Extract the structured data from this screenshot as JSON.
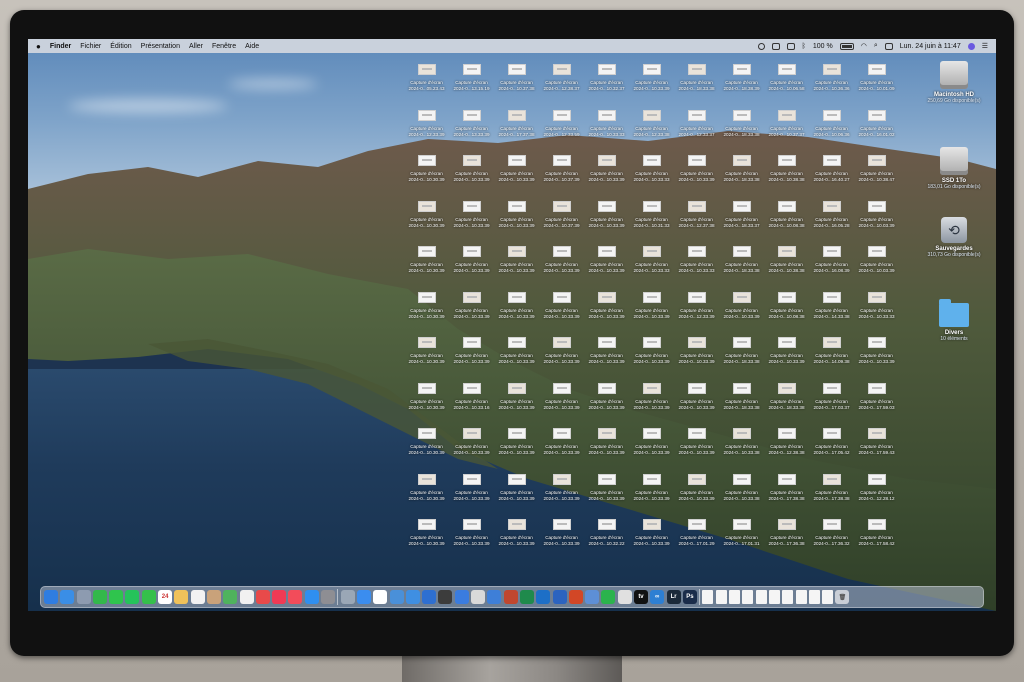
{
  "menubar": {
    "apple": "",
    "app": "Finder",
    "menus": [
      "Fichier",
      "Édition",
      "Présentation",
      "Aller",
      "Fenêtre",
      "Aide"
    ],
    "battery": "100 %",
    "clock": "Lun. 24 juin à 11:47"
  },
  "desktop": {
    "volumes": [
      {
        "name": "Macintosh HD",
        "info": "250,69 Go disponible(s)",
        "icon": "hard-disk-icon"
      },
      {
        "name": "SSD 1To",
        "info": "183,01 Go disponible(s)",
        "icon": "hard-disk-icon"
      },
      {
        "name": "Sauvegardes",
        "info": "310,73 Go disponible(s)",
        "icon": "time-machine-icon"
      },
      {
        "name": "Divers",
        "info": "10 éléments",
        "icon": "folder-icon"
      }
    ],
    "files": [
      [
        [
          "Capture d'écran",
          "2024-0...05.23.43"
        ],
        [
          "Capture d'écran",
          "2024-0...13.15.19"
        ],
        [
          "Capture d'écran",
          "2024-0...10.37.38"
        ],
        [
          "Capture d'écran",
          "2024-0...12.38.37"
        ],
        [
          "Capture d'écran",
          "2024-0...10.32.37"
        ],
        [
          "Capture d'écran",
          "2024-0...10.33.39"
        ],
        [
          "Capture d'écran",
          "2024-0...18.33.38"
        ],
        [
          "Capture d'écran",
          "2024-0...18.38.39"
        ],
        [
          "Capture d'écran",
          "2024-0...10.06.58"
        ],
        [
          "Capture d'écran",
          "2024-0...10.36.36"
        ],
        [
          "Capture d'écran",
          "2024-0...10.01.09"
        ]
      ],
      [
        [
          "Capture d'écran",
          "2024-0...12.33.39"
        ],
        [
          "Capture d'écran",
          "2024-0...13.33.39"
        ],
        [
          "Capture d'écran",
          "2024-0...17.37.38"
        ],
        [
          "Capture d'écran",
          "2024-0...12.33.59"
        ],
        [
          "Capture d'écran",
          "2024-0...10.33.33"
        ],
        [
          "Capture d'écran",
          "2024-0...12.33.38"
        ],
        [
          "Capture d'écran",
          "2024-0...12.33.37"
        ],
        [
          "Capture d'écran",
          "2024-0...18.33.38"
        ],
        [
          "Capture d'écran",
          "2024-0...10.37.37"
        ],
        [
          "Capture d'écran",
          "2024-0...10.06.36"
        ],
        [
          "Capture d'écran",
          "2024-0...16.01.02"
        ]
      ],
      [
        [
          "Capture d'écran",
          "2024-0...10.30.39"
        ],
        [
          "Capture d'écran",
          "2024-0...10.33.39"
        ],
        [
          "Capture d'écran",
          "2024-0...10.33.39"
        ],
        [
          "Capture d'écran",
          "2024-0...10.37.39"
        ],
        [
          "Capture d'écran",
          "2024-0...10.33.39"
        ],
        [
          "Capture d'écran",
          "2024-0...10.33.33"
        ],
        [
          "Capture d'écran",
          "2024-0...10.33.39"
        ],
        [
          "Capture d'écran",
          "2024-0...18.33.38"
        ],
        [
          "Capture d'écran",
          "2024-0...10.38.38"
        ],
        [
          "Capture d'écran",
          "2024-0...16.40.27"
        ],
        [
          "Capture d'écran",
          "2024-0...10.38.47"
        ]
      ],
      [
        [
          "Capture d'écran",
          "2024-0...10.30.39"
        ],
        [
          "Capture d'écran",
          "2024-0...10.33.39"
        ],
        [
          "Capture d'écran",
          "2024-0...10.33.39"
        ],
        [
          "Capture d'écran",
          "2024-0...10.37.39"
        ],
        [
          "Capture d'écran",
          "2024-0...10.33.39"
        ],
        [
          "Capture d'écran",
          "2024-0...10.31.33"
        ],
        [
          "Capture d'écran",
          "2024-0...12.37.38"
        ],
        [
          "Capture d'écran",
          "2024-0...18.33.37"
        ],
        [
          "Capture d'écran",
          "2024-0...10.08.38"
        ],
        [
          "Capture d'écran",
          "2024-0...16.05.28"
        ],
        [
          "Capture d'écran",
          "2024-0...10.03.39"
        ]
      ],
      [
        [
          "Capture d'écran",
          "2024-0...10.30.39"
        ],
        [
          "Capture d'écran",
          "2024-0...10.33.39"
        ],
        [
          "Capture d'écran",
          "2024-0...10.33.39"
        ],
        [
          "Capture d'écran",
          "2024-0...10.33.39"
        ],
        [
          "Capture d'écran",
          "2024-0...10.33.39"
        ],
        [
          "Capture d'écran",
          "2024-0...10.33.33"
        ],
        [
          "Capture d'écran",
          "2024-0...10.33.33"
        ],
        [
          "Capture d'écran",
          "2024-0...18.33.38"
        ],
        [
          "Capture d'écran",
          "2024-0...10.38.38"
        ],
        [
          "Capture d'écran",
          "2024-0...16.08.39"
        ],
        [
          "Capture d'écran",
          "2024-0...10.03.39"
        ]
      ],
      [
        [
          "Capture d'écran",
          "2024-0...10.30.39"
        ],
        [
          "Capture d'écran",
          "2024-0...10.33.39"
        ],
        [
          "Capture d'écran",
          "2024-0...10.33.39"
        ],
        [
          "Capture d'écran",
          "2024-0...10.33.39"
        ],
        [
          "Capture d'écran",
          "2024-0...10.33.39"
        ],
        [
          "Capture d'écran",
          "2024-0...10.33.39"
        ],
        [
          "Capture d'écran",
          "2024-0...12.33.39"
        ],
        [
          "Capture d'écran",
          "2024-0...10.33.39"
        ],
        [
          "Capture d'écran",
          "2024-0...10.08.38"
        ],
        [
          "Capture d'écran",
          "2024-0...14.33.38"
        ],
        [
          "Capture d'écran",
          "2024-0...10.33.33"
        ]
      ],
      [
        [
          "Capture d'écran",
          "2024-0...10.30.39"
        ],
        [
          "Capture d'écran",
          "2024-0...10.33.39"
        ],
        [
          "Capture d'écran",
          "2024-0...10.33.39"
        ],
        [
          "Capture d'écran",
          "2024-0...10.33.39"
        ],
        [
          "Capture d'écran",
          "2024-0...10.33.39"
        ],
        [
          "Capture d'écran",
          "2024-0...10.33.39"
        ],
        [
          "Capture d'écran",
          "2024-0...10.33.39"
        ],
        [
          "Capture d'écran",
          "2024-0...18.33.38"
        ],
        [
          "Capture d'écran",
          "2024-0...10.33.39"
        ],
        [
          "Capture d'écran",
          "2024-0...14.09.38"
        ],
        [
          "Capture d'écran",
          "2024-0...10.33.39"
        ]
      ],
      [
        [
          "Capture d'écran",
          "2024-0...10.30.39"
        ],
        [
          "Capture d'écran",
          "2024-0...10.33.16"
        ],
        [
          "Capture d'écran",
          "2024-0...10.33.39"
        ],
        [
          "Capture d'écran",
          "2024-0...10.33.39"
        ],
        [
          "Capture d'écran",
          "2024-0...10.33.39"
        ],
        [
          "Capture d'écran",
          "2024-0...10.33.39"
        ],
        [
          "Capture d'écran",
          "2024-0...10.33.39"
        ],
        [
          "Capture d'écran",
          "2024-0...18.33.38"
        ],
        [
          "Capture d'écran",
          "2024-0...18.33.38"
        ],
        [
          "Capture d'écran",
          "2024-0...17.03.37"
        ],
        [
          "Capture d'écran",
          "2024-0...17.59.03"
        ]
      ],
      [
        [
          "Capture d'écran",
          "2024-0...10.30.39"
        ],
        [
          "Capture d'écran",
          "2024-0...10.33.39"
        ],
        [
          "Capture d'écran",
          "2024-0...10.33.39"
        ],
        [
          "Capture d'écran",
          "2024-0...10.33.39"
        ],
        [
          "Capture d'écran",
          "2024-0...10.33.39"
        ],
        [
          "Capture d'écran",
          "2024-0...10.33.39"
        ],
        [
          "Capture d'écran",
          "2024-0...10.33.39"
        ],
        [
          "Capture d'écran",
          "2024-0...10.33.38"
        ],
        [
          "Capture d'écran",
          "2024-0...12.38.38"
        ],
        [
          "Capture d'écran",
          "2024-0...17.05.42"
        ],
        [
          "Capture d'écran",
          "2024-0...17.59.43"
        ]
      ],
      [
        [
          "Capture d'écran",
          "2024-0...10.30.39"
        ],
        [
          "Capture d'écran",
          "2024-0...10.33.39"
        ],
        [
          "Capture d'écran",
          "2024-0...10.33.39"
        ],
        [
          "Capture d'écran",
          "2024-0...10.33.39"
        ],
        [
          "Capture d'écran",
          "2024-0...10.33.39"
        ],
        [
          "Capture d'écran",
          "2024-0...10.33.39"
        ],
        [
          "Capture d'écran",
          "2024-0...10.33.39"
        ],
        [
          "Capture d'écran",
          "2024-0...10.33.38"
        ],
        [
          "Capture d'écran",
          "2024-0...17.38.38"
        ],
        [
          "Capture d'écran",
          "2024-0...17.38.38"
        ],
        [
          "Capture d'écran",
          "2024-0...12.28.12"
        ]
      ],
      [
        [
          "Capture d'écran",
          "2024-0...10.30.39"
        ],
        [
          "Capture d'écran",
          "2024-0...10.33.39"
        ],
        [
          "Capture d'écran",
          "2024-0...10.33.39"
        ],
        [
          "Capture d'écran",
          "2024-0...10.33.39"
        ],
        [
          "Capture d'écran",
          "2024-0...10.32.22"
        ],
        [
          "Capture d'écran",
          "2024-0...10.33.39"
        ],
        [
          "Capture d'écran",
          "2024-0...17.01.29"
        ],
        [
          "Capture d'écran",
          "2024-0...17.01.31"
        ],
        [
          "Capture d'écran",
          "2024-0...17.36.38"
        ],
        [
          "Capture d'écran",
          "2024-0...17.36.32"
        ],
        [
          "Capture d'écran",
          "2024-0...17.58.42"
        ]
      ]
    ]
  },
  "dock": {
    "apps": [
      {
        "name": "finder-icon",
        "color": "#2f7de1",
        "label": ""
      },
      {
        "name": "safari-icon",
        "color": "#3a8ee6",
        "label": ""
      },
      {
        "name": "launchpad-icon",
        "color": "#8d9bb0",
        "label": ""
      },
      {
        "name": "facetime-icon",
        "color": "#33b84a",
        "label": ""
      },
      {
        "name": "messages-icon",
        "color": "#2fc44d",
        "label": ""
      },
      {
        "name": "whatsapp-icon",
        "color": "#25c35a",
        "label": ""
      },
      {
        "name": "messages-green-icon",
        "color": "#35c04b",
        "label": ""
      },
      {
        "name": "calendar-icon",
        "color": "#ffffff",
        "label": "24"
      },
      {
        "name": "notes-icon",
        "color": "#f0c25a",
        "label": ""
      },
      {
        "name": "reminders-icon",
        "color": "#f2f2f2",
        "label": ""
      },
      {
        "name": "contacts-icon",
        "color": "#c9a27a",
        "label": ""
      },
      {
        "name": "maps-icon",
        "color": "#4fb35d",
        "label": ""
      },
      {
        "name": "photos-icon",
        "color": "#f1f1f1",
        "label": ""
      },
      {
        "name": "news-icon",
        "color": "#e84a4a",
        "label": ""
      },
      {
        "name": "music-icon",
        "color": "#f03a55",
        "label": ""
      },
      {
        "name": "podcasts-icon",
        "color": "#f24c5a",
        "label": ""
      },
      {
        "name": "app-store-icon",
        "color": "#2f8ff0",
        "label": ""
      },
      {
        "name": "system-settings-icon",
        "color": "#8e8e93",
        "label": ""
      }
    ],
    "apps2": [
      {
        "name": "preview-icon",
        "color": "#9aa7b6",
        "label": ""
      },
      {
        "name": "mail-icon",
        "color": "#3b8def",
        "label": ""
      },
      {
        "name": "vpn-icon",
        "color": "#ffffff",
        "label": ""
      },
      {
        "name": "chrome-icon",
        "color": "#4a90d9",
        "label": ""
      },
      {
        "name": "browser-icon",
        "color": "#3f8fe2",
        "label": ""
      },
      {
        "name": "globe-icon",
        "color": "#2e6fd1",
        "label": ""
      },
      {
        "name": "clock-icon",
        "color": "#3c3c3c",
        "label": ""
      },
      {
        "name": "xcode-icon",
        "color": "#3a7cdf",
        "label": ""
      },
      {
        "name": "pencil-icon",
        "color": "#d9d9d9",
        "label": ""
      },
      {
        "name": "tasks-icon",
        "color": "#3e7fd8",
        "label": ""
      },
      {
        "name": "camera-icon",
        "color": "#c0472f",
        "label": ""
      },
      {
        "name": "excel-icon",
        "color": "#1f8a4c",
        "label": ""
      },
      {
        "name": "outlook-icon",
        "color": "#1d6fc7",
        "label": ""
      },
      {
        "name": "word-icon",
        "color": "#2b63bf",
        "label": ""
      },
      {
        "name": "powerpoint-icon",
        "color": "#d24726",
        "label": ""
      },
      {
        "name": "maps2-icon",
        "color": "#5d8fd6",
        "label": ""
      },
      {
        "name": "facetime2-icon",
        "color": "#2bb34d",
        "label": ""
      },
      {
        "name": "logo-icon",
        "color": "#e0e0e0",
        "label": ""
      },
      {
        "name": "apple-tv-icon",
        "color": "#111111",
        "label": "tv"
      },
      {
        "name": "infinity-icon",
        "color": "#2d7fd3",
        "label": "∞"
      },
      {
        "name": "lightroom-icon",
        "color": "#1b2a3a",
        "label": "Lr"
      },
      {
        "name": "photoshop-icon",
        "color": "#1a2c4a",
        "label": "Ps"
      }
    ],
    "docs": 10
  },
  "wallpaper": {
    "sky": "#7ea3c9",
    "sea": "#1f3b5b"
  }
}
